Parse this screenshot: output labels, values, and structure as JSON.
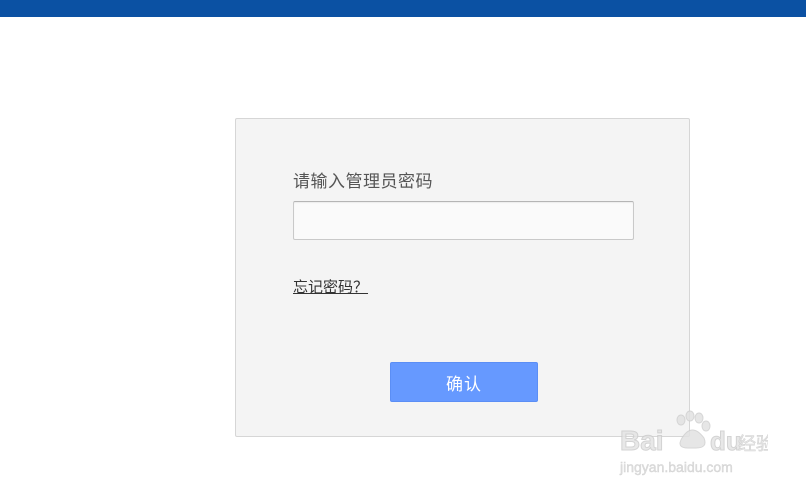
{
  "header": {
    "bar_color": "#0b51a3"
  },
  "login": {
    "prompt": "请输入管理员密码",
    "password_value": "",
    "password_placeholder": "",
    "forgot_link": "忘记密码？",
    "confirm_label": "确认",
    "confirm_color": "#6699ff"
  },
  "watermark": {
    "brand": "Bai du 经验",
    "url": "jingyan.baidu.com"
  }
}
